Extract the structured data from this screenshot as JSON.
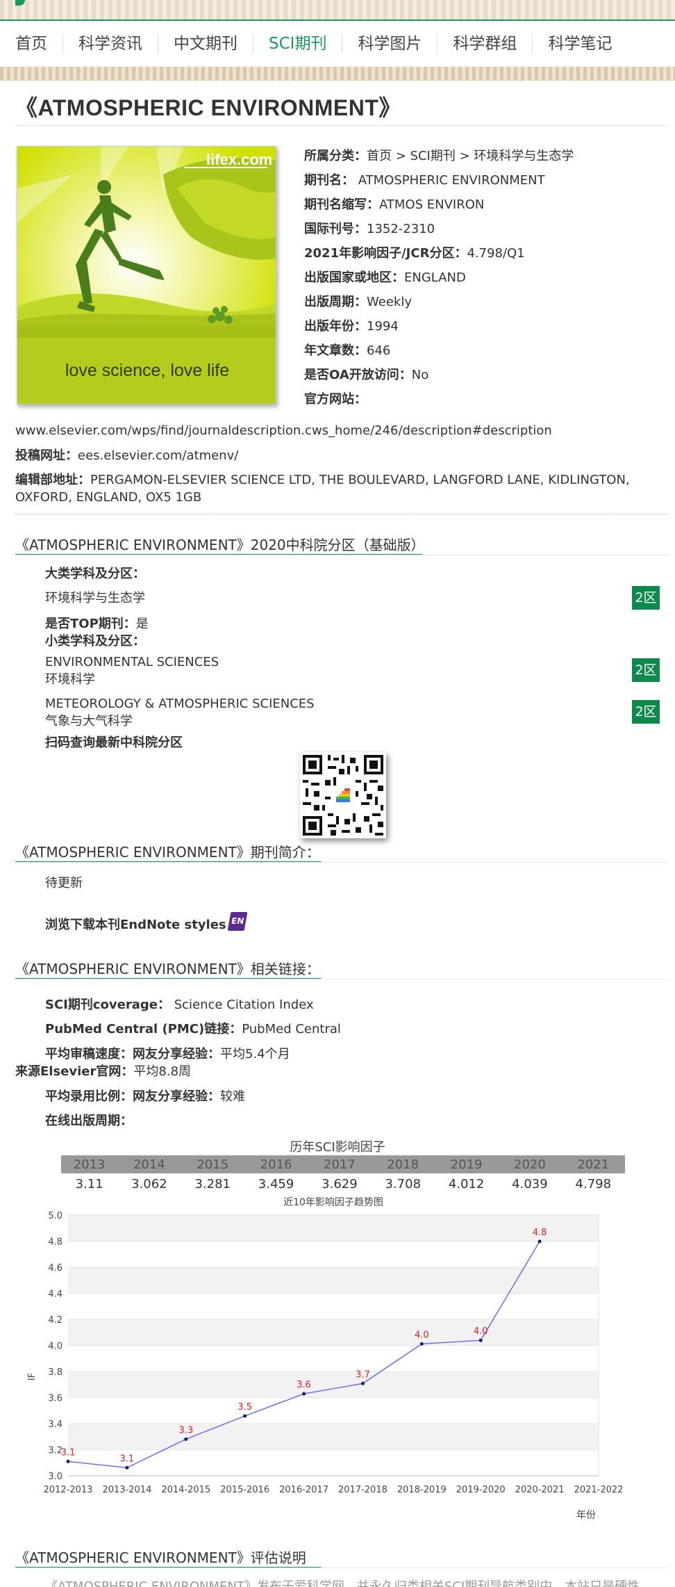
{
  "nav": {
    "items": [
      "首页",
      "科学资讯",
      "中文期刊",
      "SCI期刊",
      "科学图片",
      "科学群组",
      "科学笔记"
    ],
    "active_index": 3,
    "accent": "#1a9a5a"
  },
  "title": "《ATMOSPHERIC ENVIRONMENT》",
  "cover": {
    "site_label": "lifex.com",
    "caption": "love science, love life"
  },
  "info": {
    "category_label": "所属分类：",
    "category_value": "首页 > SCI期刊 > 环境科学与生态学",
    "name_label": "期刊名：",
    "name_value": "ATMOSPHERIC ENVIRONMENT",
    "abbr_label": "期刊名缩写：",
    "abbr_value": "ATMOS ENVIRON",
    "issn_label": "国际刊号：",
    "issn_value": "1352-2310",
    "if_label": "2021年影响因子/JCR分区：",
    "if_value": "4.798/Q1",
    "country_label": "出版国家或地区：",
    "country_value": "ENGLAND",
    "cycle_label": "出版周期：",
    "cycle_value": "Weekly",
    "year_label": "出版年份：",
    "year_value": "1994",
    "articles_label": "年文章数：",
    "articles_value": "646",
    "oa_label": "是否OA开放访问：",
    "oa_value": "No",
    "website_label": "官方网站："
  },
  "website_url": "www.elsevier.com/wps/find/journaldescription.cws_home/246/description#description",
  "submit_label": "投稿网址：",
  "submit_url": "ees.elsevier.com/atmenv/",
  "editorial_label": "编辑部地址：",
  "editorial_address_1": "PERGAMON-ELSEVIER SCIENCE LTD, THE BOULEVARD, LANGFORD LANE, KIDLINGTON,",
  "editorial_address_2": "OXFORD, ENGLAND, OX5 1GB",
  "partition": {
    "heading": "《ATMOSPHERIC ENVIRONMENT》2020中科院分区（基础版）",
    "major_label": "大类学科及分区：",
    "major_subject": "环境科学与生态学",
    "major_zone": "2区",
    "top_label": "是否TOP期刊：",
    "top_value": "是",
    "minor_label": "小类学科及分区：",
    "minor_1_en": "ENVIRONMENTAL SCIENCES",
    "minor_1_cn": "环境科学",
    "minor_1_zone": "2区",
    "minor_2_en": "METEOROLOGY & ATMOSPHERIC SCIENCES",
    "minor_2_cn": "气象与大气科学",
    "minor_2_zone": "2区",
    "scan_label": "扫码查询最新中科院分区"
  },
  "intro": {
    "heading": "《ATMOSPHERIC ENVIRONMENT》期刊简介：",
    "text": "待更新",
    "endnote_label": "浏览下载本刊EndNote styles",
    "endnote_badge": "EN"
  },
  "links": {
    "heading": "《ATMOSPHERIC ENVIRONMENT》相关链接：",
    "coverage_label": "SCI期刊coverage：",
    "coverage_value": "Science Citation Index",
    "pmc_label": "PubMed Central (PMC)链接：",
    "pmc_value": "PubMed Central",
    "review_label": "平均审稿速度：网友分享经验：",
    "review_value": "平均5.4个月",
    "elsevier_label": "来源Elsevier官网：",
    "elsevier_value": "平均8.8周",
    "accept_label": "平均录用比例：网友分享经验：",
    "accept_value": "较难",
    "online_label": "在线出版周期："
  },
  "if_table": {
    "caption": "历年SCI影响因子",
    "years": [
      "2013",
      "2014",
      "2015",
      "2016",
      "2017",
      "2018",
      "2019",
      "2020",
      "2021"
    ],
    "values": [
      "3.11",
      "3.062",
      "3.281",
      "3.459",
      "3.629",
      "3.708",
      "4.012",
      "4.039",
      "4.798"
    ]
  },
  "chart_data": {
    "type": "line",
    "title": "近10年影响因子趋势图",
    "xlabel": "年份",
    "ylabel": "IF",
    "categories": [
      "2012-2013",
      "2013-2014",
      "2014-2015",
      "2015-2016",
      "2016-2017",
      "2017-2018",
      "2018-2019",
      "2019-2020",
      "2020-2021",
      "2021-2022"
    ],
    "values": [
      3.11,
      3.062,
      3.281,
      3.459,
      3.629,
      3.708,
      4.012,
      4.039,
      4.798
    ],
    "data_labels": [
      "3.1",
      "3.1",
      "3.3",
      "3.5",
      "3.6",
      "3.7",
      "4.0",
      "4.0",
      "4.8"
    ],
    "ylim": [
      3.0,
      5.0
    ],
    "yticks": [
      "3.0",
      "3.2",
      "3.4",
      "3.6",
      "3.8",
      "4.0",
      "4.2",
      "4.4",
      "4.6",
      "4.8",
      "5.0"
    ],
    "line_color": "#6b6bf0",
    "label_color": "#e02020",
    "grid": true
  },
  "evaluation": {
    "heading": "《ATMOSPHERIC ENVIRONMENT》评估说明",
    "text": "《ATMOSPHERIC ENVIRONMENT》发布于爱科学网，并永久归类相关SCI期刊导航类别中，本站只是硬性"
  }
}
